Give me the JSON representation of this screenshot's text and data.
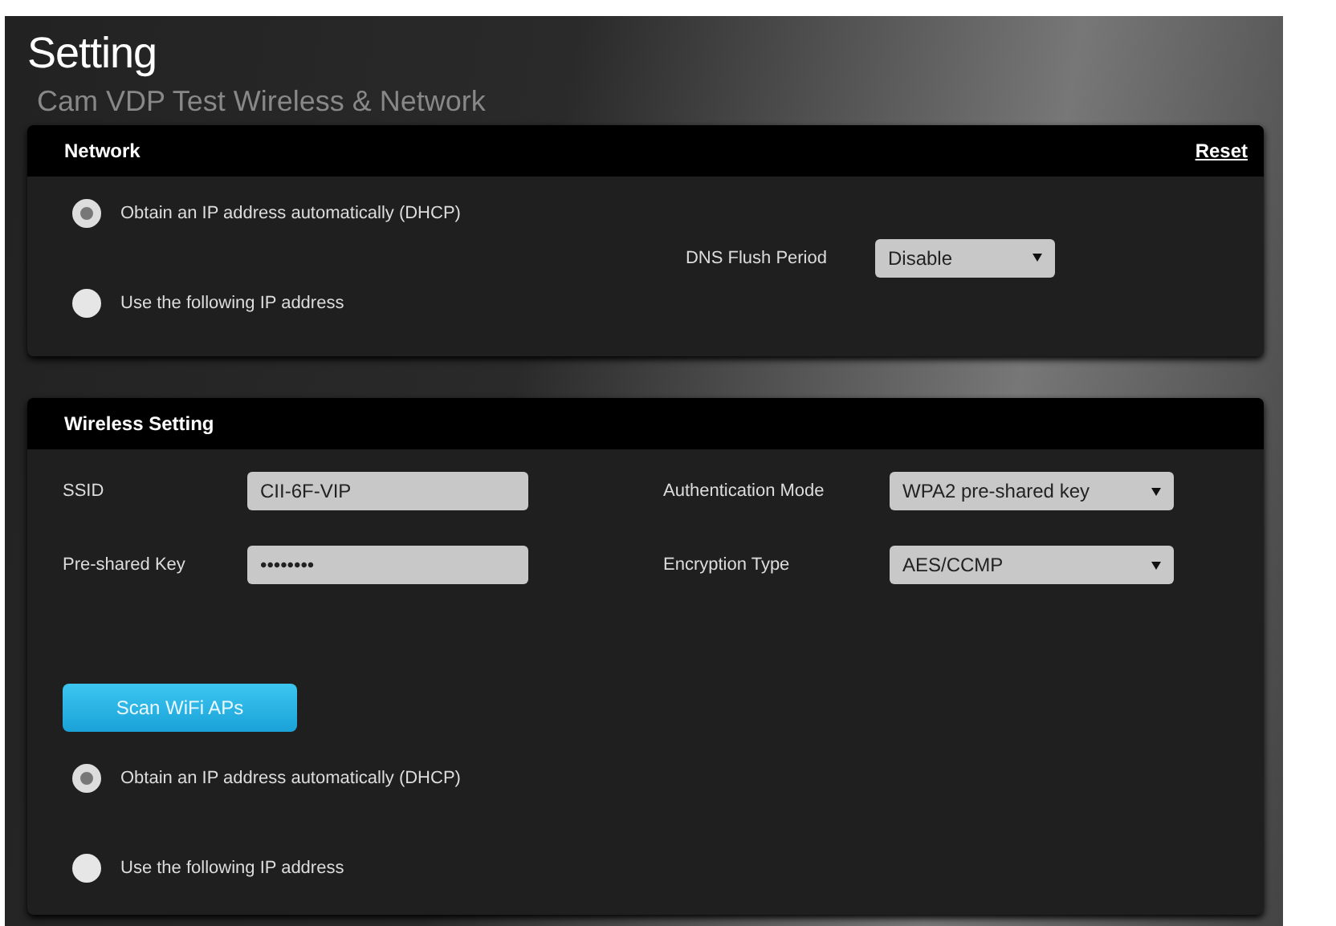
{
  "page": {
    "title": "Setting",
    "subtitle": "Cam VDP Test Wireless & Network"
  },
  "network": {
    "title": "Network",
    "reset": "Reset",
    "options": [
      {
        "label": "Obtain an IP address automatically (DHCP)",
        "selected": true
      },
      {
        "label": "Use the following IP address",
        "selected": false
      }
    ],
    "dns": {
      "label": "DNS Flush Period",
      "value": "Disable"
    }
  },
  "wireless": {
    "title": "Wireless Setting",
    "fields": [
      {
        "label": "SSID",
        "kind": "text",
        "value": "CII-6F-VIP"
      },
      {
        "label": "Authentication Mode",
        "kind": "select",
        "value": "WPA2 pre-shared key"
      },
      {
        "label": "Pre-shared Key",
        "kind": "text",
        "value": "••••••••"
      },
      {
        "label": "Encryption Type",
        "kind": "select",
        "value": "AES/CCMP"
      }
    ],
    "scan_button": "Scan WiFi APs",
    "options": [
      {
        "label": "Obtain an IP address automatically (DHCP)",
        "selected": true
      },
      {
        "label": "Use the following IP address",
        "selected": false
      }
    ]
  }
}
